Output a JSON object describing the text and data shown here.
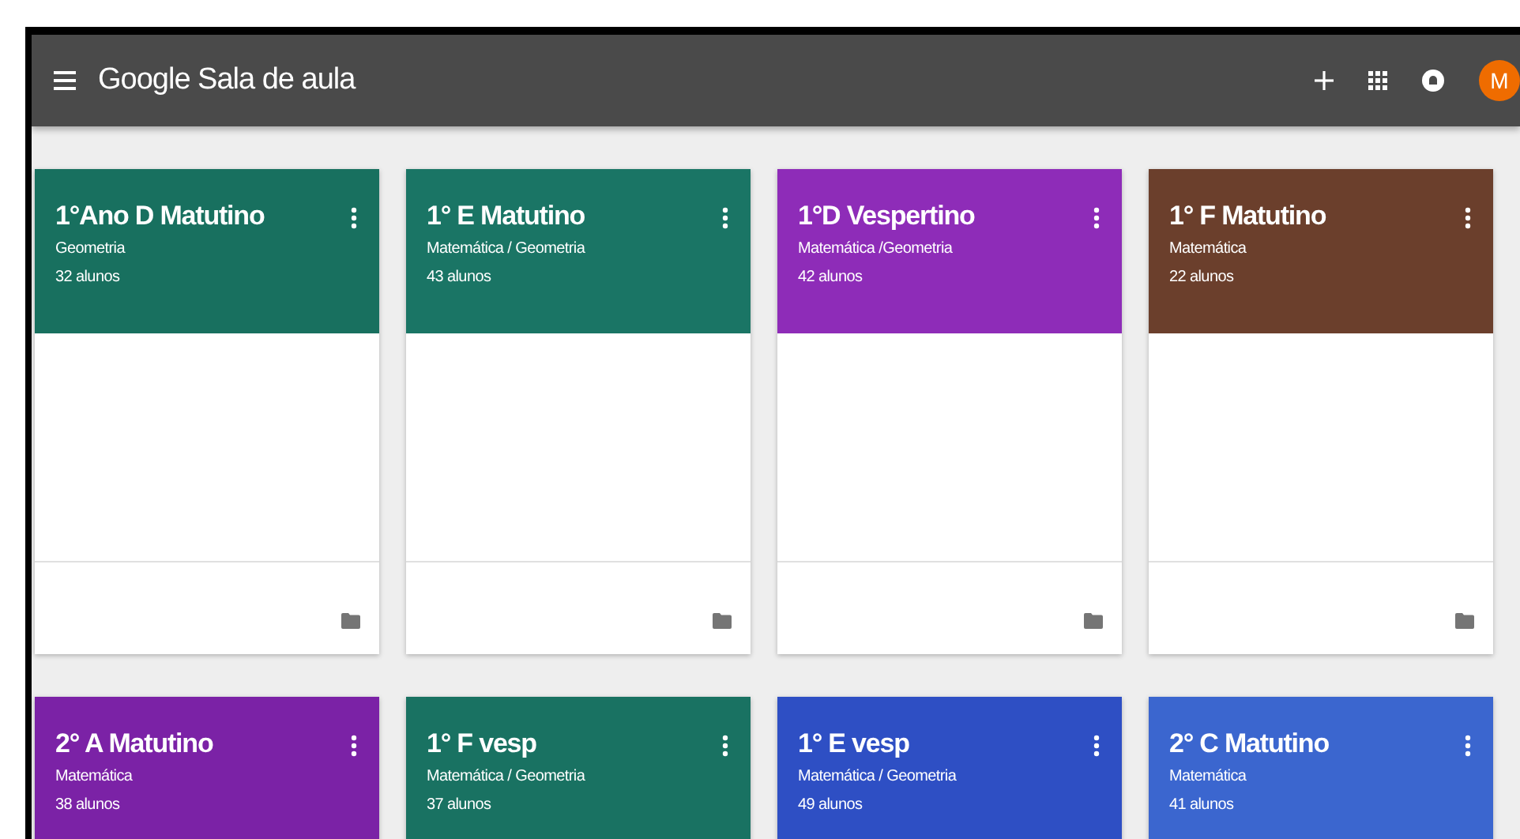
{
  "app_bar": {
    "title": "Google Sala de aula",
    "avatar_initial": "M"
  },
  "classes": [
    {
      "name": "1°Ano D Matutino",
      "subject": "Geometria",
      "students": "32 alunos",
      "color": "#18705f"
    },
    {
      "name": "1° E Matutino",
      "subject": "Matemática / Geometria",
      "students": "43 alunos",
      "color": "#1a7565"
    },
    {
      "name": "1°D Vespertino",
      "subject": "Matemática /Geometria",
      "students": "42 alunos",
      "color": "#8e2cb8"
    },
    {
      "name": "1° F Matutino",
      "subject": "Matemática",
      "students": "22 alunos",
      "color": "#6b3f2c"
    },
    {
      "name": "2° A Matutino",
      "subject": "Matemática",
      "students": "38 alunos",
      "color": "#7b22a6"
    },
    {
      "name": "1° F vesp",
      "subject": "Matemática / Geometria",
      "students": "37 alunos",
      "color": "#197262"
    },
    {
      "name": "1° E vesp",
      "subject": "Matemática / Geometria",
      "students": "49 alunos",
      "color": "#2e4fc4"
    },
    {
      "name": "2° C Matutino",
      "subject": "Matemática",
      "students": "41 alunos",
      "color": "#3b66cf"
    }
  ]
}
